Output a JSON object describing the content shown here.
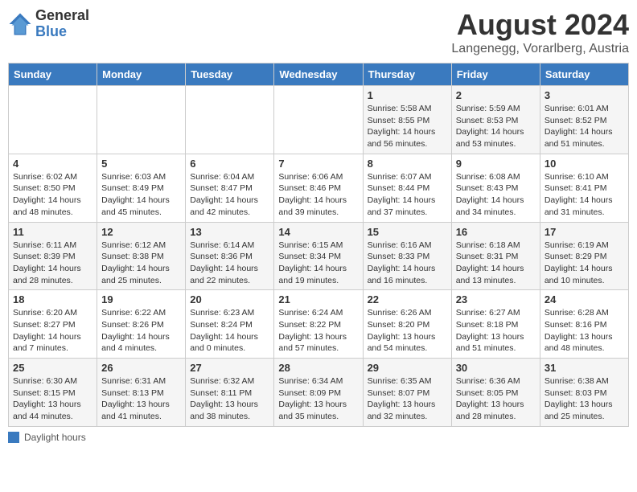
{
  "logo": {
    "general": "General",
    "blue": "Blue"
  },
  "title": {
    "month_year": "August 2024",
    "location": "Langenegg, Vorarlberg, Austria"
  },
  "weekdays": [
    "Sunday",
    "Monday",
    "Tuesday",
    "Wednesday",
    "Thursday",
    "Friday",
    "Saturday"
  ],
  "weeks": [
    [
      {
        "day": "",
        "info": ""
      },
      {
        "day": "",
        "info": ""
      },
      {
        "day": "",
        "info": ""
      },
      {
        "day": "",
        "info": ""
      },
      {
        "day": "1",
        "info": "Sunrise: 5:58 AM\nSunset: 8:55 PM\nDaylight: 14 hours\nand 56 minutes."
      },
      {
        "day": "2",
        "info": "Sunrise: 5:59 AM\nSunset: 8:53 PM\nDaylight: 14 hours\nand 53 minutes."
      },
      {
        "day": "3",
        "info": "Sunrise: 6:01 AM\nSunset: 8:52 PM\nDaylight: 14 hours\nand 51 minutes."
      }
    ],
    [
      {
        "day": "4",
        "info": "Sunrise: 6:02 AM\nSunset: 8:50 PM\nDaylight: 14 hours\nand 48 minutes."
      },
      {
        "day": "5",
        "info": "Sunrise: 6:03 AM\nSunset: 8:49 PM\nDaylight: 14 hours\nand 45 minutes."
      },
      {
        "day": "6",
        "info": "Sunrise: 6:04 AM\nSunset: 8:47 PM\nDaylight: 14 hours\nand 42 minutes."
      },
      {
        "day": "7",
        "info": "Sunrise: 6:06 AM\nSunset: 8:46 PM\nDaylight: 14 hours\nand 39 minutes."
      },
      {
        "day": "8",
        "info": "Sunrise: 6:07 AM\nSunset: 8:44 PM\nDaylight: 14 hours\nand 37 minutes."
      },
      {
        "day": "9",
        "info": "Sunrise: 6:08 AM\nSunset: 8:43 PM\nDaylight: 14 hours\nand 34 minutes."
      },
      {
        "day": "10",
        "info": "Sunrise: 6:10 AM\nSunset: 8:41 PM\nDaylight: 14 hours\nand 31 minutes."
      }
    ],
    [
      {
        "day": "11",
        "info": "Sunrise: 6:11 AM\nSunset: 8:39 PM\nDaylight: 14 hours\nand 28 minutes."
      },
      {
        "day": "12",
        "info": "Sunrise: 6:12 AM\nSunset: 8:38 PM\nDaylight: 14 hours\nand 25 minutes."
      },
      {
        "day": "13",
        "info": "Sunrise: 6:14 AM\nSunset: 8:36 PM\nDaylight: 14 hours\nand 22 minutes."
      },
      {
        "day": "14",
        "info": "Sunrise: 6:15 AM\nSunset: 8:34 PM\nDaylight: 14 hours\nand 19 minutes."
      },
      {
        "day": "15",
        "info": "Sunrise: 6:16 AM\nSunset: 8:33 PM\nDaylight: 14 hours\nand 16 minutes."
      },
      {
        "day": "16",
        "info": "Sunrise: 6:18 AM\nSunset: 8:31 PM\nDaylight: 14 hours\nand 13 minutes."
      },
      {
        "day": "17",
        "info": "Sunrise: 6:19 AM\nSunset: 8:29 PM\nDaylight: 14 hours\nand 10 minutes."
      }
    ],
    [
      {
        "day": "18",
        "info": "Sunrise: 6:20 AM\nSunset: 8:27 PM\nDaylight: 14 hours\nand 7 minutes."
      },
      {
        "day": "19",
        "info": "Sunrise: 6:22 AM\nSunset: 8:26 PM\nDaylight: 14 hours\nand 4 minutes."
      },
      {
        "day": "20",
        "info": "Sunrise: 6:23 AM\nSunset: 8:24 PM\nDaylight: 14 hours\nand 0 minutes."
      },
      {
        "day": "21",
        "info": "Sunrise: 6:24 AM\nSunset: 8:22 PM\nDaylight: 13 hours\nand 57 minutes."
      },
      {
        "day": "22",
        "info": "Sunrise: 6:26 AM\nSunset: 8:20 PM\nDaylight: 13 hours\nand 54 minutes."
      },
      {
        "day": "23",
        "info": "Sunrise: 6:27 AM\nSunset: 8:18 PM\nDaylight: 13 hours\nand 51 minutes."
      },
      {
        "day": "24",
        "info": "Sunrise: 6:28 AM\nSunset: 8:16 PM\nDaylight: 13 hours\nand 48 minutes."
      }
    ],
    [
      {
        "day": "25",
        "info": "Sunrise: 6:30 AM\nSunset: 8:15 PM\nDaylight: 13 hours\nand 44 minutes."
      },
      {
        "day": "26",
        "info": "Sunrise: 6:31 AM\nSunset: 8:13 PM\nDaylight: 13 hours\nand 41 minutes."
      },
      {
        "day": "27",
        "info": "Sunrise: 6:32 AM\nSunset: 8:11 PM\nDaylight: 13 hours\nand 38 minutes."
      },
      {
        "day": "28",
        "info": "Sunrise: 6:34 AM\nSunset: 8:09 PM\nDaylight: 13 hours\nand 35 minutes."
      },
      {
        "day": "29",
        "info": "Sunrise: 6:35 AM\nSunset: 8:07 PM\nDaylight: 13 hours\nand 32 minutes."
      },
      {
        "day": "30",
        "info": "Sunrise: 6:36 AM\nSunset: 8:05 PM\nDaylight: 13 hours\nand 28 minutes."
      },
      {
        "day": "31",
        "info": "Sunrise: 6:38 AM\nSunset: 8:03 PM\nDaylight: 13 hours\nand 25 minutes."
      }
    ]
  ],
  "footer": {
    "legend_label": "Daylight hours"
  }
}
